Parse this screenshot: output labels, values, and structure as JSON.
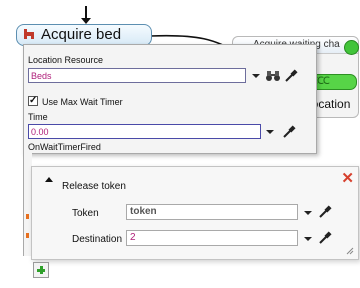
{
  "canvas": {
    "activity_node_label": "Acquire bed",
    "bg_activity_header": "Acquire waiting cha",
    "bg_location_text": "Location"
  },
  "properties": {
    "location_resource_label": "Location Resource",
    "location_resource_value": "Beds",
    "use_max_wait_timer_label": "Use Max Wait Timer",
    "use_max_wait_timer_checked": true,
    "time_label": "Time",
    "time_value": "0.00",
    "on_wait_timer_fired_label": "OnWaitTimerFired"
  },
  "release_token": {
    "title": "Release token",
    "token_label": "Token",
    "token_value": "token",
    "destination_label": "Destination",
    "destination_value": "2"
  },
  "colors": {
    "accent_magenta": "#b0207a",
    "close_red": "#d6402e",
    "add_green": "#2fa02a",
    "token_green": "#57d447"
  },
  "icons": [
    "arrow-down-icon",
    "activity-node-icon",
    "dropdown-arrow-icon",
    "binoculars-icon",
    "eyedropper-icon",
    "close-icon",
    "collapse-icon",
    "add-icon",
    "resize-grip-icon"
  ]
}
